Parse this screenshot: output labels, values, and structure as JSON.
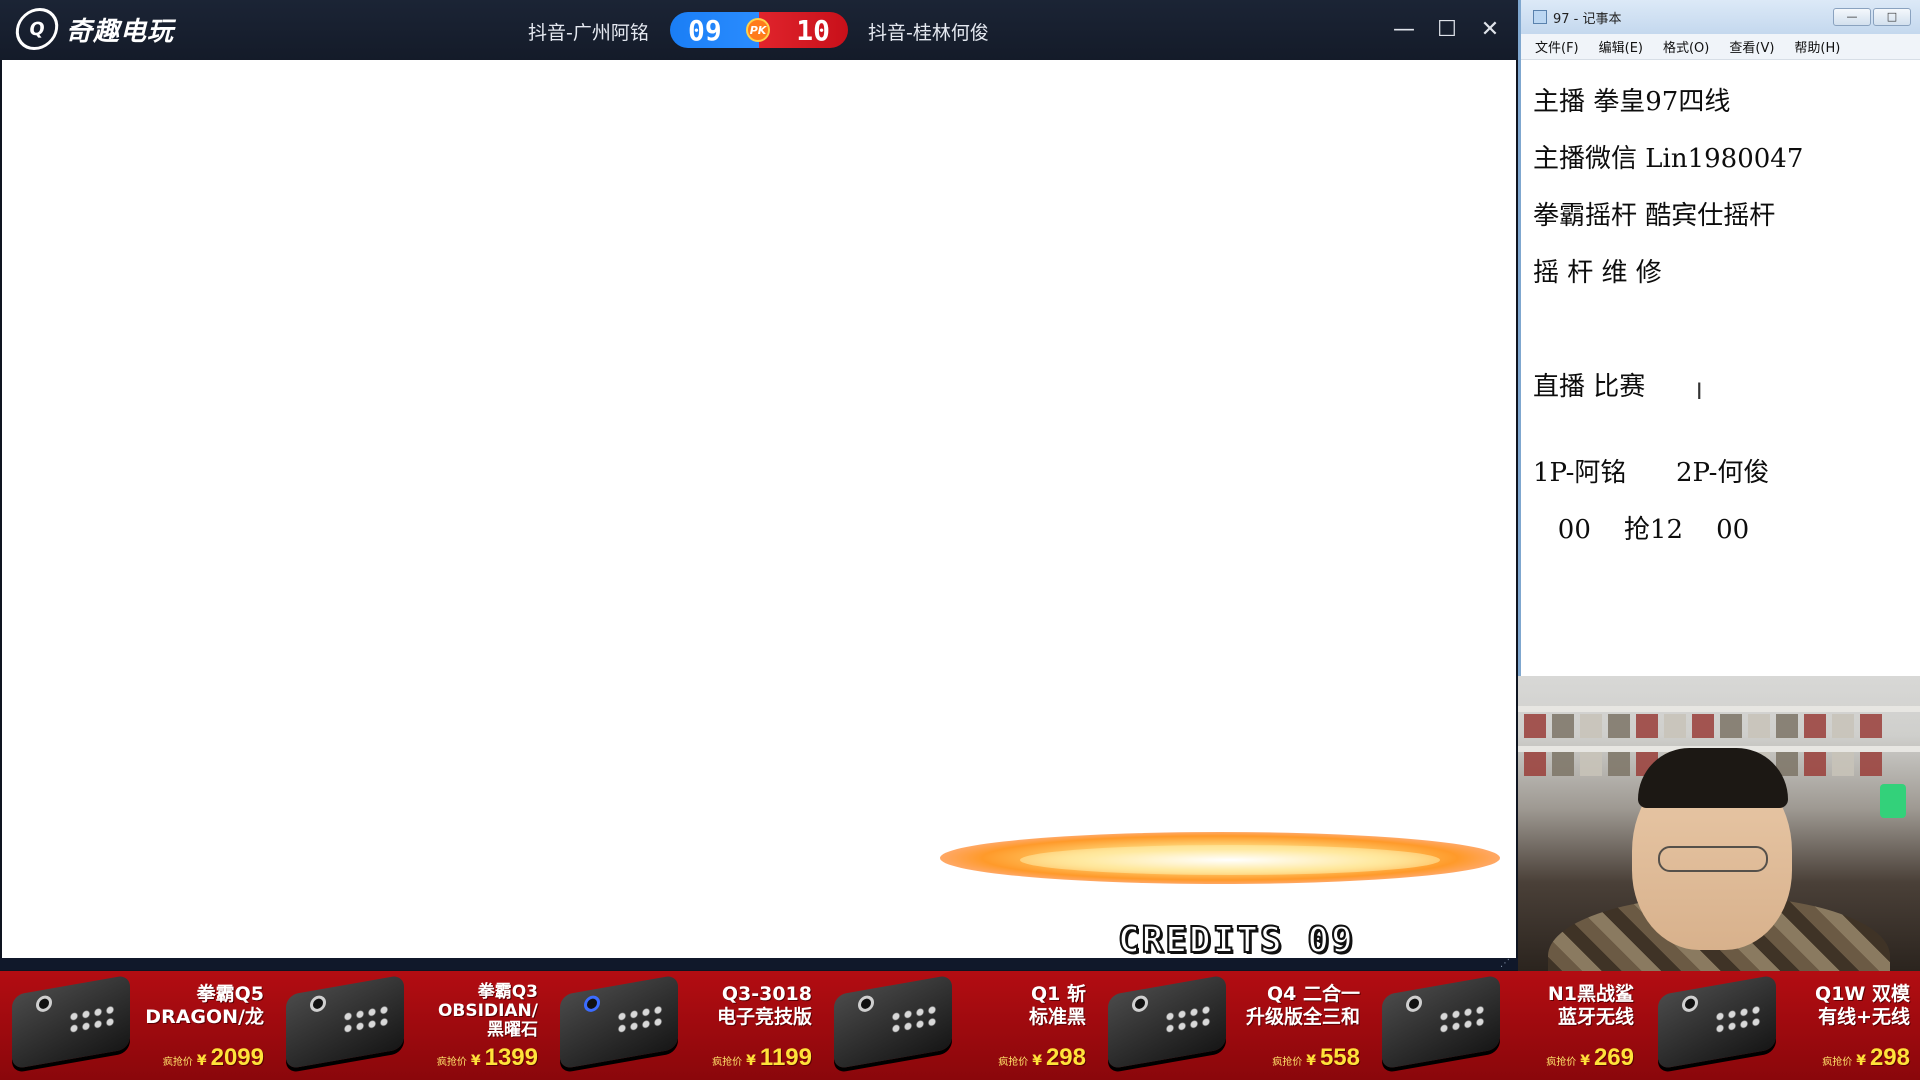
{
  "game_window": {
    "logo_mark": "Q",
    "logo_text": "奇趣电玩",
    "player1": "抖音-广州阿铭",
    "player2": "抖音-桂林何俊",
    "score1": "09",
    "score2": "10",
    "pk_label": "PK",
    "minimize": "—",
    "maximize": "☐",
    "close": "✕",
    "credits_text": "CREDITS 09"
  },
  "notepad": {
    "title": "97 - 记事本",
    "menu": [
      "文件(F)",
      "编辑(E)",
      "格式(O)",
      "查看(V)",
      "帮助(H)"
    ],
    "btn_min": "—",
    "btn_max": "□",
    "lines": [
      "主播 拳皇97四线",
      "主播微信 Lin1980047",
      "拳霸摇杆 酷宾仕摇杆",
      "摇 杆 维 修",
      "",
      "直播 比赛",
      "1P-阿铭      2P-何俊",
      "   00    抢12    00"
    ]
  },
  "ads": [
    {
      "title": "拳霸Q5\nDRAGON/龙",
      "price_tag": "疯抢价",
      "currency": "¥",
      "price": "2099"
    },
    {
      "title": "拳霸Q3\nOBSIDIAN/\n黑曜石",
      "price_tag": "疯抢价",
      "currency": "¥",
      "price": "1399"
    },
    {
      "title": "Q3-3018\n电子竞技版",
      "price_tag": "疯抢价",
      "currency": "¥",
      "price": "1199"
    },
    {
      "title": "Q1 斩\n标准黑",
      "price_tag": "疯抢价",
      "currency": "¥",
      "price": "298"
    },
    {
      "title": "Q4 二合一\n升级版全三和",
      "price_tag": "疯抢价",
      "currency": "¥",
      "price": "558"
    },
    {
      "title": "N1黑战鲨\n蓝牙无线",
      "price_tag": "疯抢价",
      "currency": "¥",
      "price": "269"
    },
    {
      "title": "Q1W 双模\n有线+无线",
      "price_tag": "疯抢价",
      "currency": "¥",
      "price": "298"
    }
  ]
}
